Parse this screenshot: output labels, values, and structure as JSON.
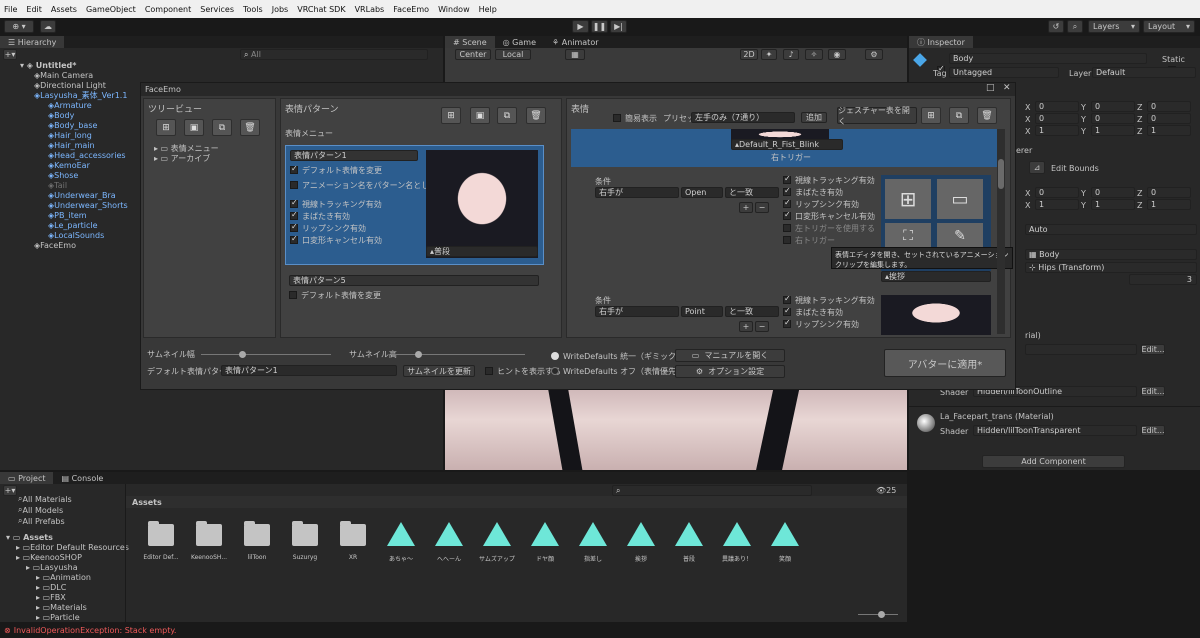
{
  "menu": [
    "File",
    "Edit",
    "Assets",
    "GameObject",
    "Component",
    "Services",
    "Tools",
    "Jobs",
    "VRChat SDK",
    "VRLabs",
    "FaceEmo",
    "Window",
    "Help"
  ],
  "toolbar": {
    "layers": "Layers",
    "layout": "Layout"
  },
  "hierarchy": {
    "tab": "Hierarchy",
    "search_placeholder": "All",
    "scene": "Untitled*",
    "items": [
      {
        "label": "Main Camera",
        "indent": 1,
        "color": "normal"
      },
      {
        "label": "Directional Light",
        "indent": 1,
        "color": "normal"
      },
      {
        "label": "Lasyusha_素体_Ver1.1",
        "indent": 1,
        "color": "blue"
      },
      {
        "label": "Armature",
        "indent": 2,
        "color": "blue"
      },
      {
        "label": "Body",
        "indent": 2,
        "color": "blue"
      },
      {
        "label": "Body_base",
        "indent": 2,
        "color": "blue"
      },
      {
        "label": "Hair_long",
        "indent": 2,
        "color": "blue"
      },
      {
        "label": "Hair_main",
        "indent": 2,
        "color": "blue"
      },
      {
        "label": "Head_accessories",
        "indent": 2,
        "color": "blue"
      },
      {
        "label": "KemoEar",
        "indent": 2,
        "color": "blue"
      },
      {
        "label": "Shose",
        "indent": 2,
        "color": "blue"
      },
      {
        "label": "Tail",
        "indent": 2,
        "color": "gray"
      },
      {
        "label": "Underwear_Bra",
        "indent": 2,
        "color": "blue"
      },
      {
        "label": "Underwear_Shorts",
        "indent": 2,
        "color": "blue"
      },
      {
        "label": "PB_item",
        "indent": 2,
        "color": "blue"
      },
      {
        "label": "Le_particle",
        "indent": 2,
        "color": "blue"
      },
      {
        "label": "LocalSounds",
        "indent": 2,
        "color": "blue"
      },
      {
        "label": "FaceEmo",
        "indent": 1,
        "color": "normal"
      }
    ]
  },
  "scene": {
    "tabs": [
      "Scene",
      "Game",
      "Animator"
    ],
    "center": "Center",
    "local": "Local",
    "mode2d": "2D"
  },
  "inspector": {
    "tab": "Inspector",
    "name": "Body",
    "static": "Static",
    "tag_label": "Tag",
    "tag": "Untagged",
    "layer_label": "Layer",
    "layer": "Default",
    "transform_rows": [
      [
        "X",
        "0",
        "Y",
        "0",
        "Z",
        "0"
      ],
      [
        "X",
        "0",
        "Y",
        "0",
        "Z",
        "0"
      ],
      [
        "X",
        "1",
        "Y",
        "1",
        "Z",
        "1"
      ]
    ],
    "renderer_title": "erer",
    "edit_bounds": "Edit Bounds",
    "bounds_rows": [
      [
        "X",
        "0",
        "Y",
        "0",
        "Z",
        "0"
      ],
      [
        "X",
        "1",
        "Y",
        "1",
        "Z",
        "1"
      ]
    ],
    "auto": "Auto",
    "mesh": "Body",
    "root_bone": "Hips (Transform)",
    "count": "3",
    "material_suffix": "rial)",
    "shader_label": "Shader",
    "shader1": "Hidden/lilToonOutline",
    "material2": "La_Facepart_trans (Material)",
    "shader2": "Hidden/lilToonTransparent",
    "edit": "Edit...",
    "add_component": "Add Component"
  },
  "faceemo": {
    "title": "FaceEmo",
    "tree": {
      "header": "ツリービュー",
      "items": [
        "表情メニュー",
        "アーカイブ"
      ]
    },
    "patterns": {
      "header": "表情パターン",
      "menu_label": "表情メニュー",
      "p1": "表情パターン1",
      "p1_opts": [
        {
          "label": "デフォルト表情を変更",
          "on": true
        },
        {
          "label": "アニメーション名をパターン名として使用",
          "on": false
        },
        {
          "label": "視線トラッキング有効",
          "on": true
        },
        {
          "label": "まばたき有効",
          "on": true
        },
        {
          "label": "リップシンク有効",
          "on": true
        },
        {
          "label": "口変形キャンセル有効",
          "on": true
        }
      ],
      "thumb1": "普段",
      "p5": "表情パターン5",
      "p5_opt": "デフォルト表情を変更"
    },
    "expressions": {
      "header": "表情",
      "detail": "簡易表示",
      "preset_label": "プリセット",
      "preset": "左手のみ（7通り）",
      "add": "追加",
      "open_gesture": "ジェスチャー表を開く",
      "clip_top": "Default_R_Fist_Blink",
      "trigger": "右トリガー",
      "cond_label": "条件",
      "hand": "右手が",
      "gesture1": "Open",
      "equal": "と一致",
      "gesture2": "Point",
      "opts": [
        {
          "label": "視線トラッキング有効",
          "on": true
        },
        {
          "label": "まばたき有効",
          "on": true
        },
        {
          "label": "リップシンク有効",
          "on": true
        },
        {
          "label": "口変形キャンセル有効",
          "on": true
        },
        {
          "label": "左トリガーを使用する",
          "on": false
        },
        {
          "label": "右トリガー",
          "on": false
        }
      ],
      "tooltip": "表情エディタを開き、セットされているアニメーションクリップを編集します。",
      "clip_name": "挨拶"
    },
    "bottom": {
      "thumb_w": "サムネイル幅",
      "thumb_h": "サムネイル高",
      "default_label": "デフォルト表情パターン",
      "default_val": "表情パターン1",
      "update_thumb": "サムネイルを更新",
      "show_hint": "ヒントを表示する",
      "wd_on": "WriteDefaults 統一（ギミック優先）",
      "wd_off": "WriteDefaults オフ（表情優先）",
      "manual": "マニュアルを開く",
      "options": "オプション設定",
      "apply": "アバターに適用*"
    }
  },
  "project": {
    "tabs": [
      "Project",
      "Console"
    ],
    "fav": [
      "All Materials",
      "All Models",
      "All Prefabs"
    ],
    "assets_root": "Assets",
    "tree": [
      {
        "label": "Editor Default Resources",
        "indent": 1
      },
      {
        "label": "KeenooSHOP",
        "indent": 1
      },
      {
        "label": "Lasyusha",
        "indent": 2
      },
      {
        "label": "Animation",
        "indent": 3
      },
      {
        "label": "DLC",
        "indent": 3
      },
      {
        "label": "FBX",
        "indent": 3
      },
      {
        "label": "Materials",
        "indent": 3
      },
      {
        "label": "Particle",
        "indent": 3
      }
    ],
    "breadcrumb": "Assets",
    "count": "25",
    "folders": [
      "Editor Def...",
      "KeenooSH...",
      "lilToon",
      "Suzuryg",
      "XR"
    ],
    "anims": [
      "あちゃ～",
      "へへーん",
      "サムズアップ",
      "ドヤ顔",
      "指差し",
      "挨拶",
      "普段",
      "異議あり！",
      "笑顔"
    ]
  },
  "status": {
    "error": "InvalidOperationException: Stack empty."
  }
}
